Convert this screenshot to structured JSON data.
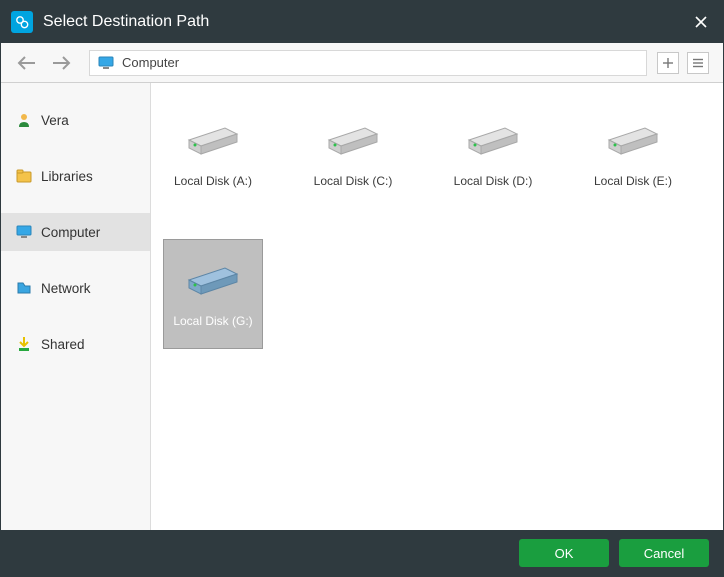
{
  "window": {
    "title": "Select Destination Path"
  },
  "navbar": {
    "location": "Computer"
  },
  "sidebar": {
    "items": [
      {
        "label": "Vera"
      },
      {
        "label": "Libraries"
      },
      {
        "label": "Computer"
      },
      {
        "label": "Network"
      },
      {
        "label": "Shared"
      }
    ]
  },
  "drives": [
    {
      "label": "Local Disk (A:)"
    },
    {
      "label": "Local Disk (C:)"
    },
    {
      "label": "Local Disk (D:)"
    },
    {
      "label": "Local Disk (E:)"
    },
    {
      "label": "Local Disk (G:)"
    }
  ],
  "footer": {
    "ok": "OK",
    "cancel": "Cancel"
  }
}
